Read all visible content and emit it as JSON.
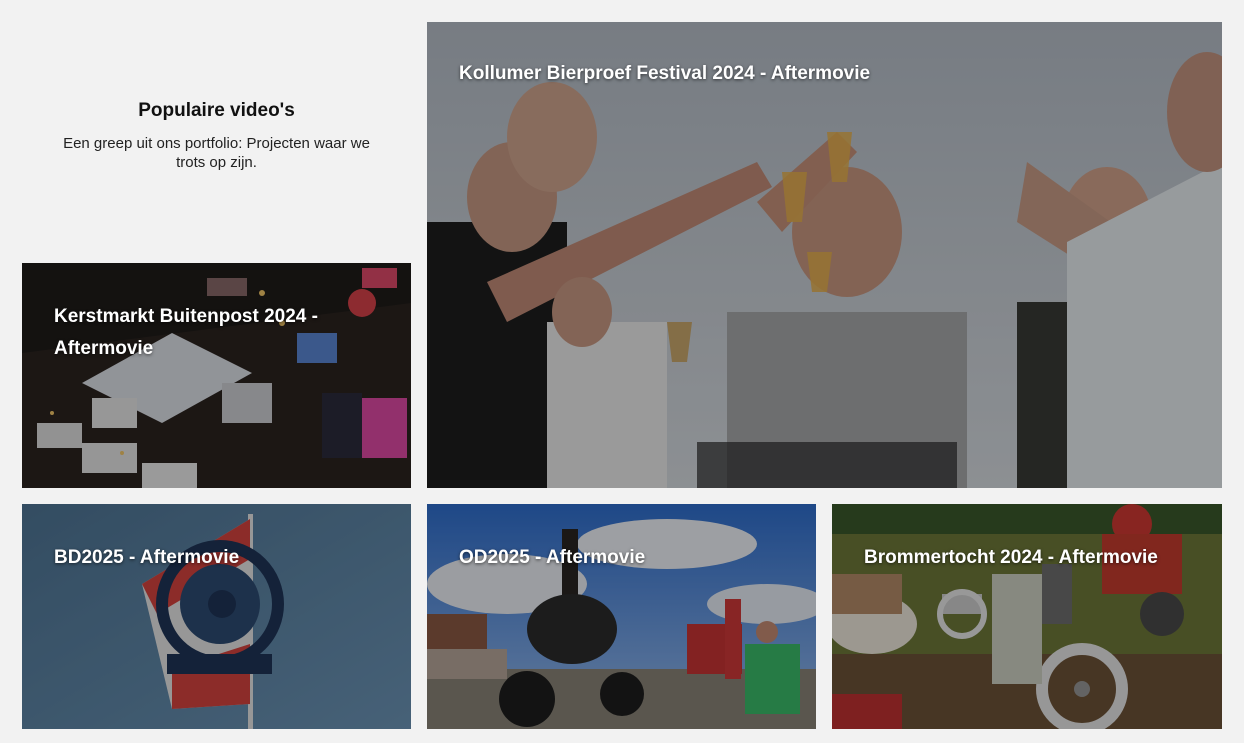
{
  "intro": {
    "heading": "Populaire video's",
    "text": "Een greep uit ons portfolio: Projecten waar we trots op zijn."
  },
  "videos": [
    {
      "title": "Kollumer Bierproef Festival 2024 - Aftermovie"
    },
    {
      "title": "Kerstmarkt Buitenpost 2024 - Aftermovie"
    },
    {
      "title": "BD2025 - Aftermovie"
    },
    {
      "title": "OD2025 - Aftermovie"
    },
    {
      "title": "Brommertocht 2024 - Aftermovie"
    }
  ],
  "colors": {
    "background": "#f2f2f2",
    "title_text": "#ffffff"
  }
}
